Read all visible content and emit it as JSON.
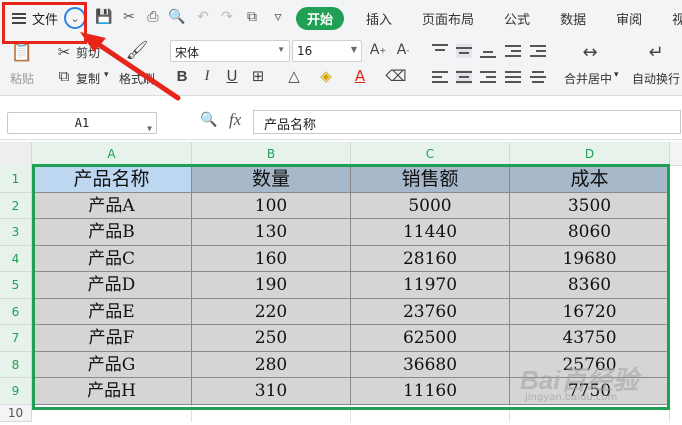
{
  "menubar": {
    "file_label": "文件",
    "tabs": [
      "开始",
      "插入",
      "页面布局",
      "公式",
      "数据",
      "审阅",
      "视图"
    ],
    "active_tab": "开始"
  },
  "ribbon": {
    "paste_label": "粘贴",
    "cut_label": "剪切",
    "copy_label": "复制",
    "format_painter_label": "格式刷",
    "font_name": "宋体",
    "font_size": "16",
    "merge_label": "合并居中",
    "wrap_label": "自动换行"
  },
  "formulabar": {
    "cell_ref": "A1",
    "fx_label": "fx",
    "formula_value": "产品名称"
  },
  "grid": {
    "columns": [
      "A",
      "B",
      "C",
      "D"
    ],
    "row_numbers": [
      "1",
      "2",
      "3",
      "4",
      "5",
      "6",
      "7",
      "8",
      "9",
      "10"
    ],
    "header": [
      "产品名称",
      "数量",
      "销售额",
      "成本"
    ],
    "rows": [
      [
        "产品A",
        "100",
        "5000",
        "3500"
      ],
      [
        "产品B",
        "130",
        "11440",
        "8060"
      ],
      [
        "产品C",
        "160",
        "28160",
        "19680"
      ],
      [
        "产品D",
        "190",
        "11970",
        "8360"
      ],
      [
        "产品E",
        "220",
        "23760",
        "16720"
      ],
      [
        "产品F",
        "250",
        "62500",
        "43750"
      ],
      [
        "产品G",
        "280",
        "36680",
        "25760"
      ],
      [
        "产品H",
        "310",
        "11160",
        "7750"
      ]
    ]
  },
  "watermark": {
    "brand": "Bai百经验",
    "url": "jingyan.baidu.com"
  },
  "colors": {
    "accent_green": "#1fa055",
    "annotation_red": "#e8251b",
    "annotation_blue": "#2b83e6",
    "header_fill": "#a8b8cb",
    "data_fill": "#d5d5d5"
  }
}
